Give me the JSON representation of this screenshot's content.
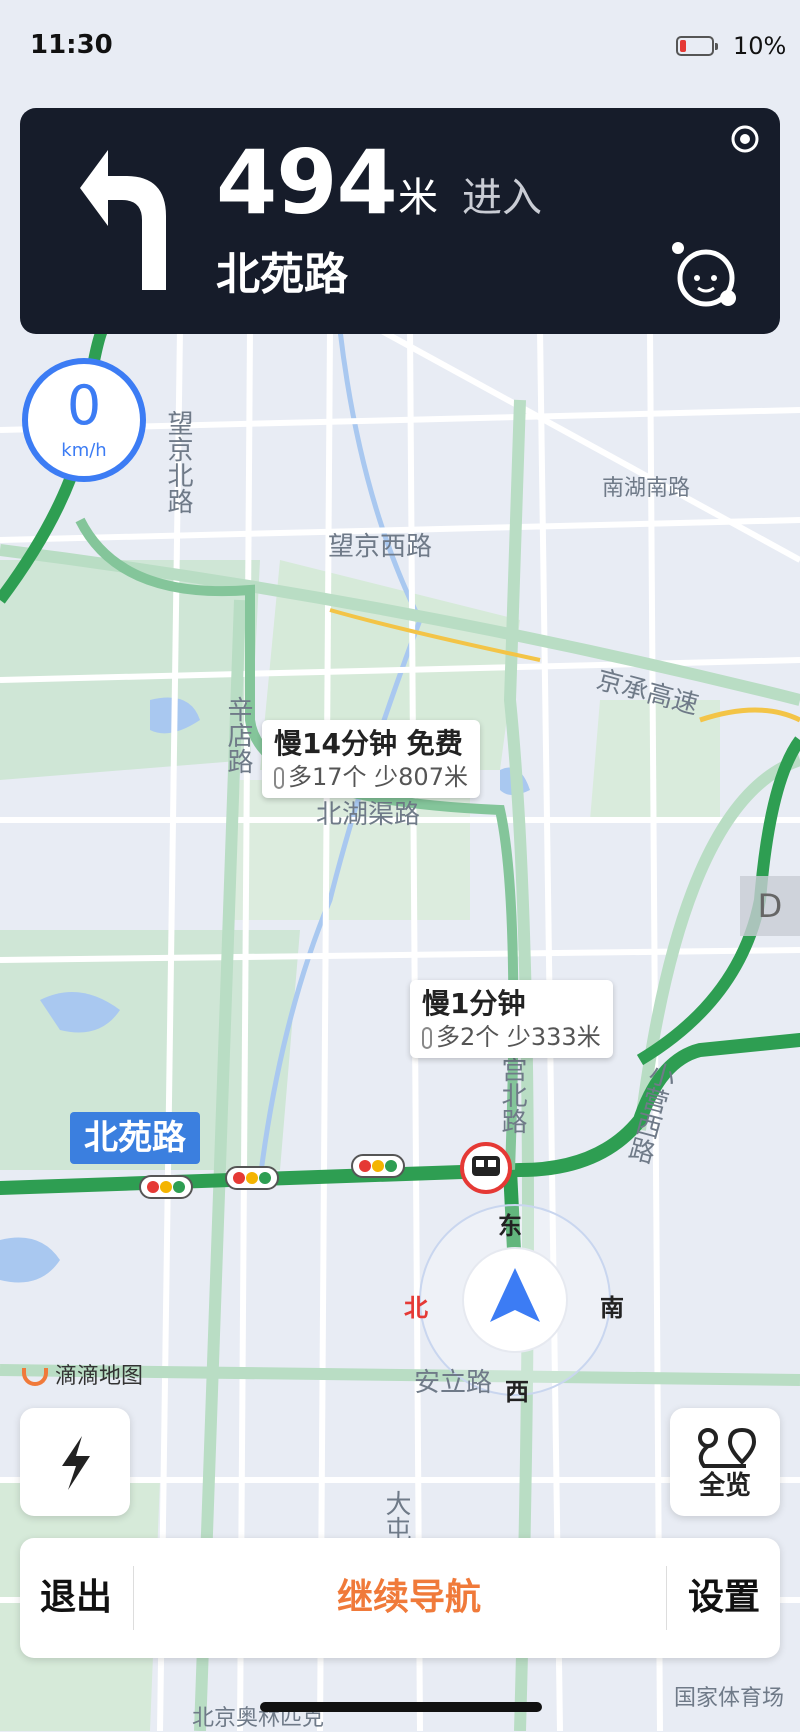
{
  "status_bar": {
    "time": "11:30",
    "battery": "10%"
  },
  "guidance": {
    "distance": "494",
    "unit": "米",
    "action": "进入",
    "road": "北苑路"
  },
  "speed": {
    "value": "0",
    "unit": "km/h"
  },
  "callouts": [
    {
      "title": "慢14分钟 免费",
      "sub": "多17个  少807米"
    },
    {
      "title": "慢1分钟",
      "sub": "多2个  少333米"
    }
  ],
  "current_road_tag": "北苑路",
  "compass": {
    "east": "东",
    "south": "南",
    "west": "西",
    "north": "北"
  },
  "map_labels": [
    "望京北路",
    "南湖南路",
    "望京西路",
    "京承高速",
    "辛店路",
    "北湖渠路",
    "宫北路",
    "小营西路",
    "安立路",
    "大屯",
    "国家体育场",
    "北京奥林匹克",
    "D"
  ],
  "logo_text": "滴滴地图",
  "overview_label": "全览",
  "bottom_bar": {
    "exit": "退出",
    "continue": "继续导航",
    "settings": "设置"
  },
  "colors": {
    "accent": "#3c7cf4",
    "route": "#2e9e52",
    "nav_card": "#161c2a",
    "continue": "#f07a3a"
  }
}
